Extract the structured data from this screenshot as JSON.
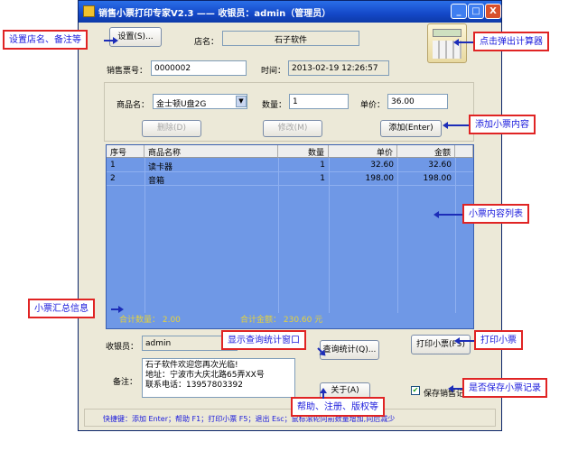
{
  "window": {
    "title": "销售小票打印专家V2.3 —— 收银员：admin（管理员）",
    "min": "_",
    "max": "□",
    "close": "X"
  },
  "top": {
    "settings_button": "设置(S)...",
    "store_label": "店名：",
    "store_name": "石子软件",
    "ticket_label": "销售票号：",
    "ticket_no": "0000002",
    "time_label": "时间：",
    "time_value": "2013-02-19 12:26:57"
  },
  "entry": {
    "product_label": "商品名：",
    "product_value": "金士顿U盘2G",
    "qty_label": "数量：",
    "qty_value": "1",
    "price_label": "单价：",
    "price_value": "36.00",
    "delete_button": "删除(D)",
    "modify_button": "修改(M)",
    "add_button": "添加(Enter)"
  },
  "table": {
    "columns": [
      "序号",
      "商品名称",
      "数量",
      "单价",
      "金额"
    ],
    "rows": [
      [
        "1",
        "读卡器",
        "1",
        "32.60",
        "32.60"
      ],
      [
        "2",
        "音箱",
        "1",
        "198.00",
        "198.00"
      ]
    ],
    "total_qty": "合计数量：  2.00",
    "total_amount": "合计金额：  230.60  元"
  },
  "bottom": {
    "cashier_label": "收银员：",
    "cashier_value": "admin",
    "query_button": "查询统计(Q)...",
    "print_button": "打印小票(F5)",
    "remarks_label": "备注：",
    "remarks_lines": [
      "石子软件欢迎您再次光临!",
      "地址：宁波市大庆北路65弄XX号",
      "联系电话：13957803392"
    ],
    "about_button": "关于(A)",
    "save_checkbox_label": "保存销售记录",
    "save_checked": true,
    "shortcuts": "快捷键：添加 Enter；帮助 F1；打印小票 F5；退出 Esc；鼠标滚轮向前数量增加,向后减少"
  },
  "annotations": {
    "store_notes": "设置店名、备注等",
    "calculator": "点击弹出计算器",
    "add_items": "添加小票内容",
    "item_list": "小票内容列表",
    "summary": "小票汇总信息",
    "query_window": "显示查询统计窗口",
    "print_ticket": "打印小票",
    "help": "帮助、注册、版权等",
    "save_record": "是否保存小票记录"
  },
  "icons": {
    "calculator": "calculator-icon",
    "app": "app-icon",
    "dropdown": "chevron-down-icon"
  },
  "colors": {
    "grid_bg": "#6f98e6",
    "title_bar": "#1448c8",
    "callout_border": "#e02424",
    "callout_text": "#1a1adc",
    "summary_text": "#e6d23a"
  }
}
